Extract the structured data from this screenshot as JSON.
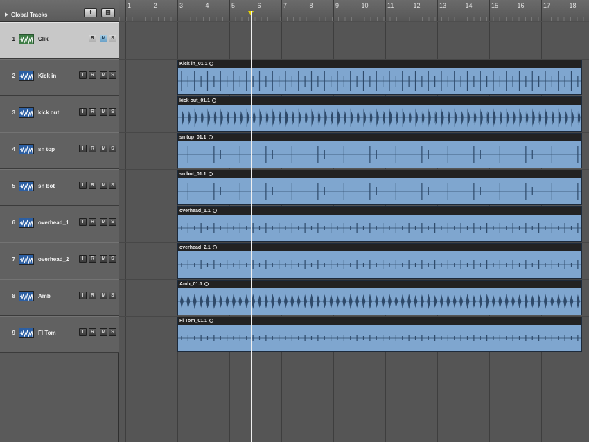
{
  "global_tracks": {
    "label": "Global Tracks",
    "add_label": "+",
    "folder_label": "⊞"
  },
  "ruler": {
    "bars": [
      "1",
      "2",
      "3",
      "4",
      "5",
      "6",
      "7",
      "8",
      "9",
      "10",
      "11",
      "12",
      "13",
      "14",
      "15",
      "16",
      "17",
      "18"
    ]
  },
  "buttons": {
    "i": "I",
    "r": "R",
    "m": "M",
    "s": "S"
  },
  "tracks": [
    {
      "number": "1",
      "name": "Clik",
      "selected": true,
      "has_input": false,
      "region": null
    },
    {
      "number": "2",
      "name": "Kick in",
      "selected": false,
      "has_input": true,
      "region": {
        "name": "Kick in_01.1",
        "pattern": "kick"
      }
    },
    {
      "number": "3",
      "name": "kick out",
      "selected": false,
      "has_input": true,
      "region": {
        "name": "kick out_01.1",
        "pattern": "kickout"
      }
    },
    {
      "number": "4",
      "name": "sn top",
      "selected": false,
      "has_input": true,
      "region": {
        "name": "sn top_01.1",
        "pattern": "snare"
      }
    },
    {
      "number": "5",
      "name": "sn bot",
      "selected": false,
      "has_input": true,
      "region": {
        "name": "sn bot_01.1",
        "pattern": "snare"
      }
    },
    {
      "number": "6",
      "name": "overhead_1",
      "selected": false,
      "has_input": true,
      "region": {
        "name": "overhead_1.1",
        "pattern": "overhead"
      }
    },
    {
      "number": "7",
      "name": "overhead_2",
      "selected": false,
      "has_input": true,
      "region": {
        "name": "overhead_2.1",
        "pattern": "overhead"
      }
    },
    {
      "number": "8",
      "name": "Amb",
      "selected": false,
      "has_input": true,
      "region": {
        "name": "Amb_01.1",
        "pattern": "amb"
      }
    },
    {
      "number": "9",
      "name": "Fl Tom",
      "selected": false,
      "has_input": true,
      "region": {
        "name": "Fl Tom_01.1",
        "pattern": "tom"
      }
    }
  ],
  "colors": {
    "region": "#7fa6cf",
    "waveform": "#2f4a6a",
    "playhead": "#f0f0f0",
    "playhead_marker": "#e8d400"
  },
  "icons": {
    "track": "waveform-icon",
    "loop": "loop-icon",
    "disclosure": "disclosure-triangle-icon"
  }
}
